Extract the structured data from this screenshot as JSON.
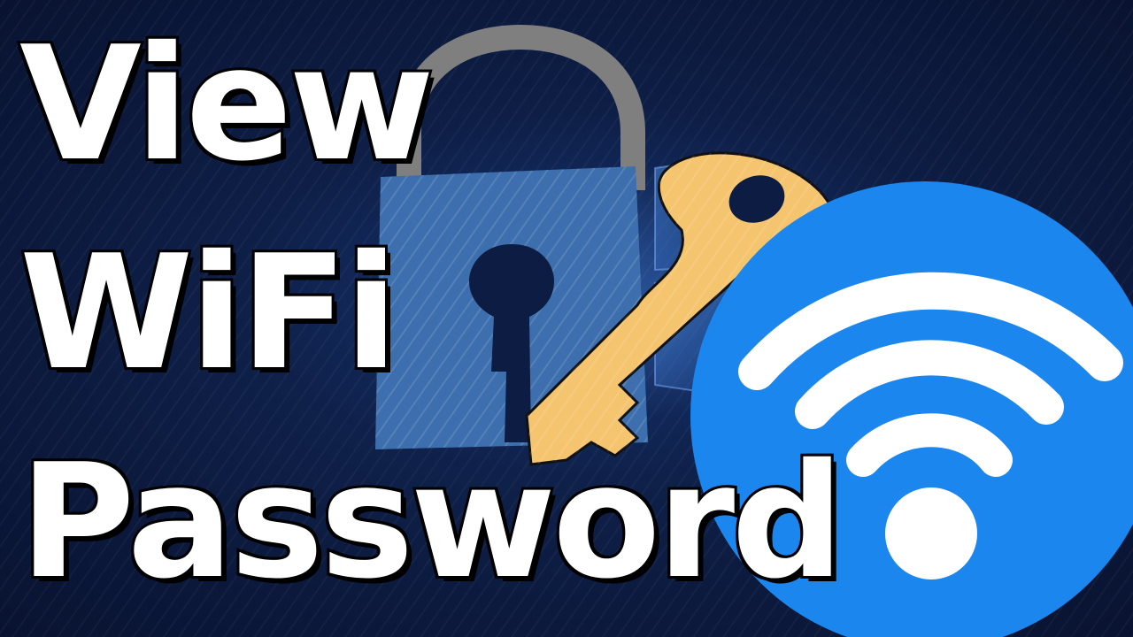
{
  "headline": {
    "line1": "View",
    "line2": "WiFi",
    "line3": "Password"
  },
  "icons": {
    "lock": "padlock-icon",
    "key": "key-icon",
    "wifi": "wifi-icon",
    "background": "windows-logo-icon"
  },
  "colors": {
    "background": "#0d1c42",
    "lock_body": "#3d6fae",
    "lock_shackle": "#7f7f7f",
    "key": "#f5c46e",
    "wifi_circle": "#1a86ee",
    "wifi_symbol": "#ffffff",
    "text": "#ffffff",
    "text_outline": "#000000"
  }
}
